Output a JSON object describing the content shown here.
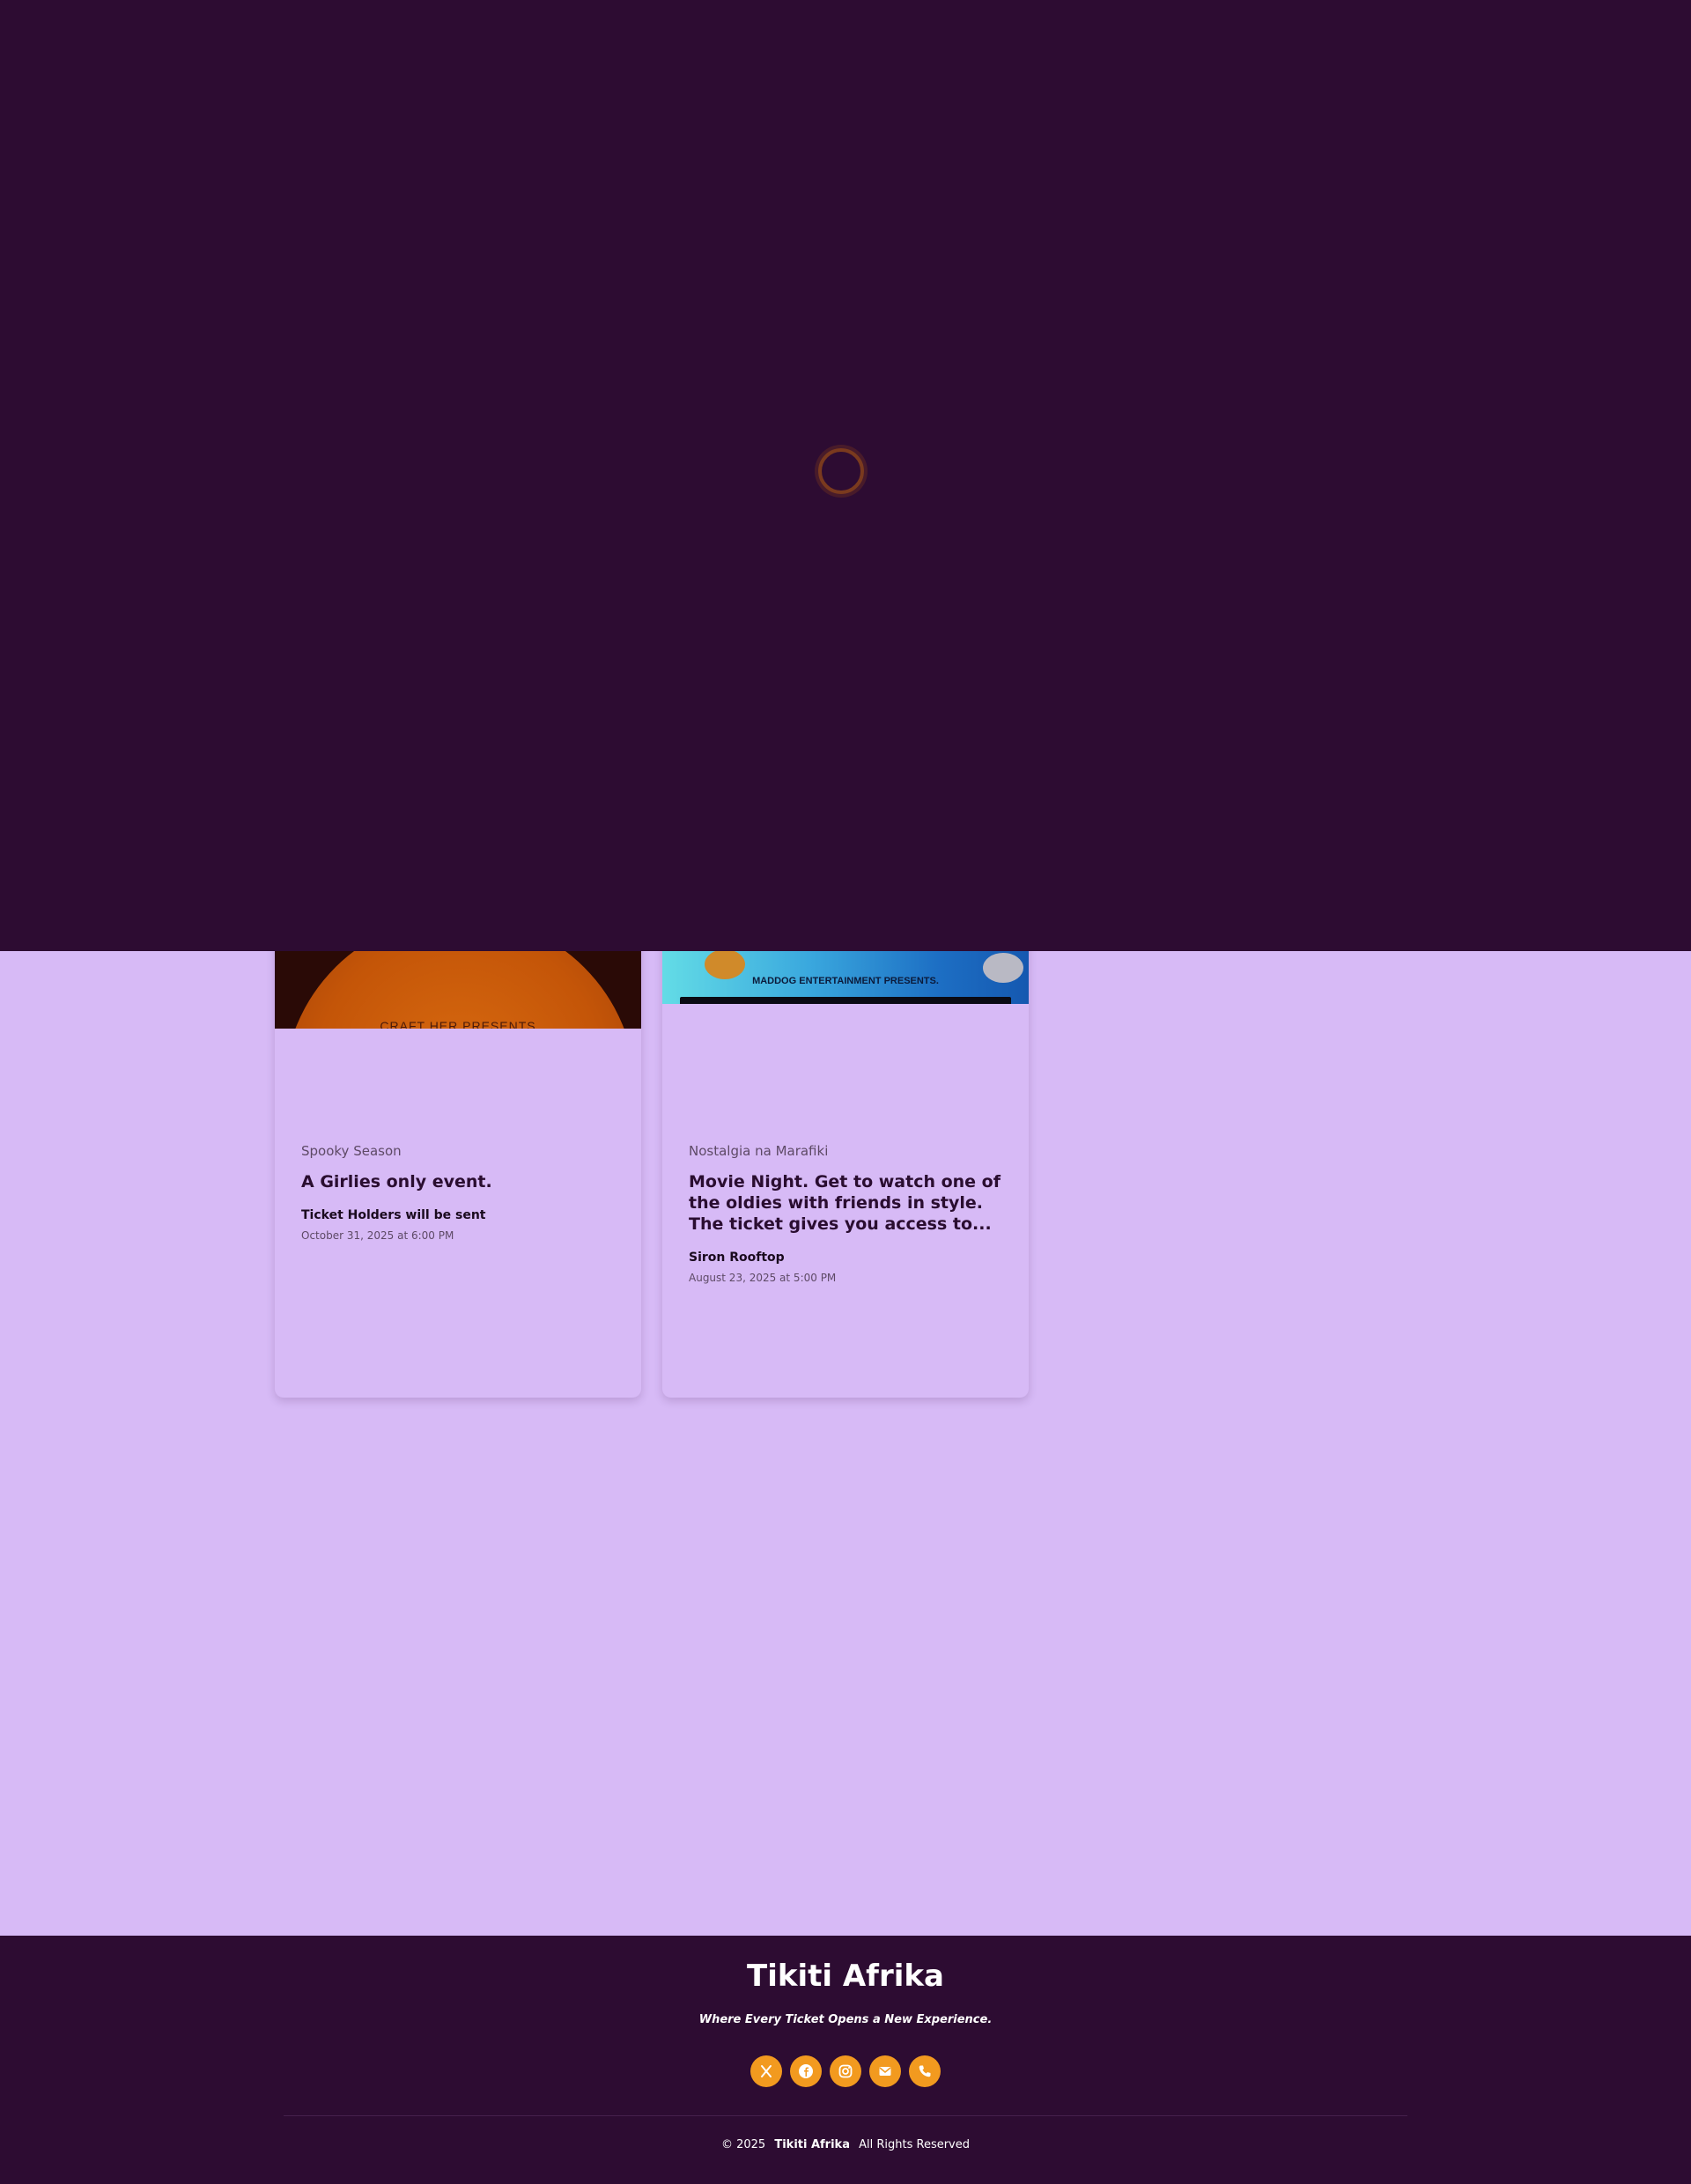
{
  "events": [
    {
      "poster_text": "CRAFT HER PRESENTS",
      "category": "Spooky Season",
      "title": "A Girlies only event.",
      "venue": "Ticket Holders will be sent",
      "date": "October 31, 2025 at 6:00 PM"
    },
    {
      "poster_text": "MADDOG ENTERTAINMENT PRESENTS.",
      "category": "Nostalgia na Marafiki",
      "title": "Movie Night. Get to watch one of the oldies with friends in style. The ticket gives you access to...",
      "venue": "Siron Rooftop",
      "date": "August 23, 2025 at 5:00 PM"
    }
  ],
  "footer": {
    "brand": "Tikiti Afrika",
    "tagline": "Where Every Ticket Opens a New Experience.",
    "social": [
      {
        "icon": "x-icon"
      },
      {
        "icon": "facebook-icon"
      },
      {
        "icon": "instagram-icon"
      },
      {
        "icon": "email-icon"
      },
      {
        "icon": "phone-icon"
      }
    ],
    "copyright_prefix": "© 2025",
    "copyright_brand": "Tikiti Afrika",
    "copyright_suffix": "All Rights Reserved"
  },
  "colors": {
    "overlay_bg": "#2d0c32",
    "page_bg": "#d7baf6",
    "accent": "#f29a1f",
    "footer_bg": "#2d0c32"
  }
}
